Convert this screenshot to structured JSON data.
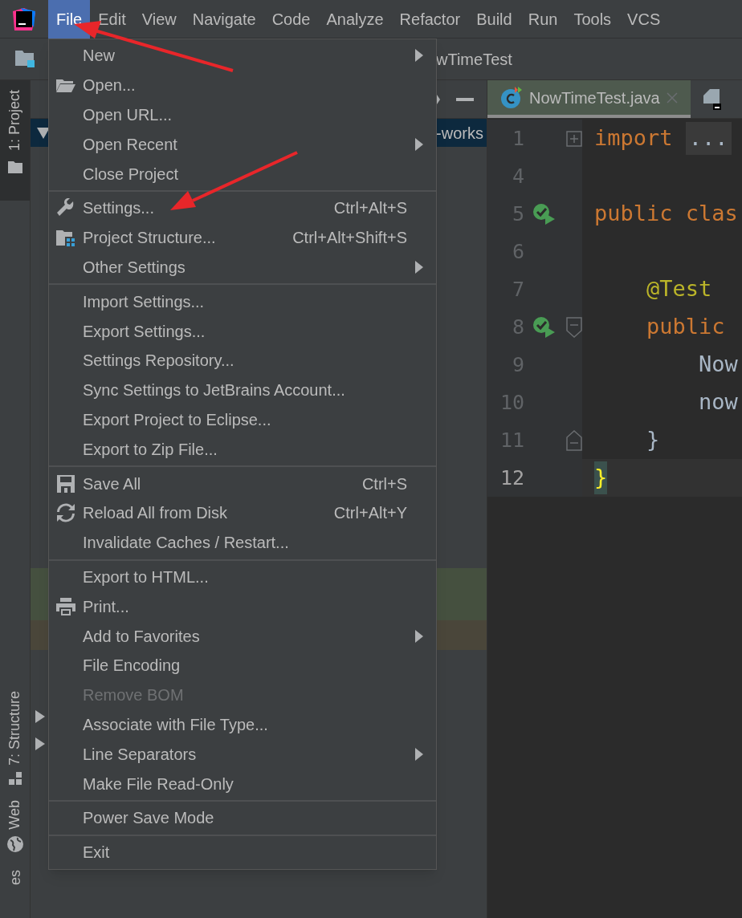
{
  "menu_bar": [
    {
      "label": "File",
      "selected": true
    },
    {
      "label": "Edit",
      "selected": false
    },
    {
      "label": "View",
      "selected": false
    },
    {
      "label": "Navigate",
      "selected": false
    },
    {
      "label": "Code",
      "selected": false
    },
    {
      "label": "Analyze",
      "selected": false
    },
    {
      "label": "Refactor",
      "selected": false
    },
    {
      "label": "Build",
      "selected": false
    },
    {
      "label": "Run",
      "selected": false
    },
    {
      "label": "Tools",
      "selected": false
    },
    {
      "label": "VCS",
      "selected": false
    }
  ],
  "breadcrumb": {
    "label": "wTimeTest"
  },
  "left_stripe": [
    {
      "label": "1: Project",
      "selected": true
    },
    {
      "label": "7: Structure",
      "selected": false
    },
    {
      "label": "Web",
      "selected": false
    },
    {
      "label": "es",
      "selected": false
    }
  ],
  "project_panel": {
    "selected_row": "-works"
  },
  "editor": {
    "tab": {
      "label": "NowTimeTest.java",
      "selected": true
    },
    "lines": [
      {
        "number": "1",
        "fold_marker": {
          "kind": "expand"
        },
        "current": false,
        "tokens": [
          {
            "kind": "keyword",
            "text": "import "
          },
          {
            "kind": "folded",
            "text": "..."
          }
        ]
      },
      {
        "number": "4",
        "current": false
      },
      {
        "number": "5",
        "run_marker": true,
        "current": false,
        "tokens": [
          {
            "kind": "keyword",
            "text": "public clas"
          }
        ]
      },
      {
        "number": "6",
        "current": false
      },
      {
        "number": "7",
        "current": false,
        "tokens": [
          {
            "kind": "annotation",
            "text": "    @Test"
          }
        ]
      },
      {
        "number": "8",
        "run_marker": true,
        "fold_marker": {
          "kind": "start"
        },
        "current": false,
        "tokens": [
          {
            "kind": "keyword",
            "text": "    public"
          }
        ]
      },
      {
        "number": "9",
        "current": false,
        "tokens": [
          {
            "kind": "plain",
            "text": "        Now"
          }
        ]
      },
      {
        "number": "10",
        "current": false,
        "tokens": [
          {
            "kind": "plain",
            "text": "        now"
          }
        ]
      },
      {
        "number": "11",
        "fold_marker": {
          "kind": "end"
        },
        "current": false,
        "tokens": [
          {
            "kind": "plain",
            "text": "    }"
          }
        ]
      },
      {
        "number": "12",
        "current": true,
        "tokens": [
          {
            "kind": "brace",
            "text": "}"
          }
        ]
      }
    ]
  },
  "file_menu": {
    "groups": [
      [
        {
          "label": "New",
          "submenu": true,
          "disabled": false
        },
        {
          "label": "Open...",
          "disabled": false
        },
        {
          "label": "Open URL...",
          "disabled": false
        },
        {
          "label": "Open Recent",
          "submenu": true,
          "disabled": false
        },
        {
          "label": "Close Project",
          "disabled": false
        }
      ],
      [
        {
          "label": "Settings...",
          "shortcut": "Ctrl+Alt+S",
          "disabled": false
        },
        {
          "label": "Project Structure...",
          "shortcut": "Ctrl+Alt+Shift+S",
          "disabled": false
        },
        {
          "label": "Other Settings",
          "submenu": true,
          "disabled": false
        }
      ],
      [
        {
          "label": "Import Settings...",
          "disabled": false
        },
        {
          "label": "Export Settings...",
          "disabled": false
        },
        {
          "label": "Settings Repository...",
          "disabled": false
        },
        {
          "label": "Sync Settings to JetBrains Account...",
          "disabled": false
        },
        {
          "label": "Export Project to Eclipse...",
          "disabled": false
        },
        {
          "label": "Export to Zip File...",
          "disabled": false
        }
      ],
      [
        {
          "label": "Save All",
          "shortcut": "Ctrl+S",
          "disabled": false
        },
        {
          "label": "Reload All from Disk",
          "shortcut": "Ctrl+Alt+Y",
          "disabled": false
        },
        {
          "label": "Invalidate Caches / Restart...",
          "disabled": false
        }
      ],
      [
        {
          "label": "Export to HTML...",
          "disabled": false
        },
        {
          "label": "Print...",
          "disabled": false
        },
        {
          "label": "Add to Favorites",
          "submenu": true,
          "disabled": false
        },
        {
          "label": "File Encoding",
          "disabled": false
        },
        {
          "label": "Remove BOM",
          "disabled": true
        },
        {
          "label": "Associate with File Type...",
          "disabled": false
        },
        {
          "label": "Line Separators",
          "submenu": true,
          "disabled": false
        },
        {
          "label": "Make File Read-Only",
          "disabled": false
        }
      ],
      [
        {
          "label": "Power Save Mode",
          "disabled": false
        }
      ],
      [
        {
          "label": "Exit",
          "disabled": false
        }
      ]
    ]
  }
}
